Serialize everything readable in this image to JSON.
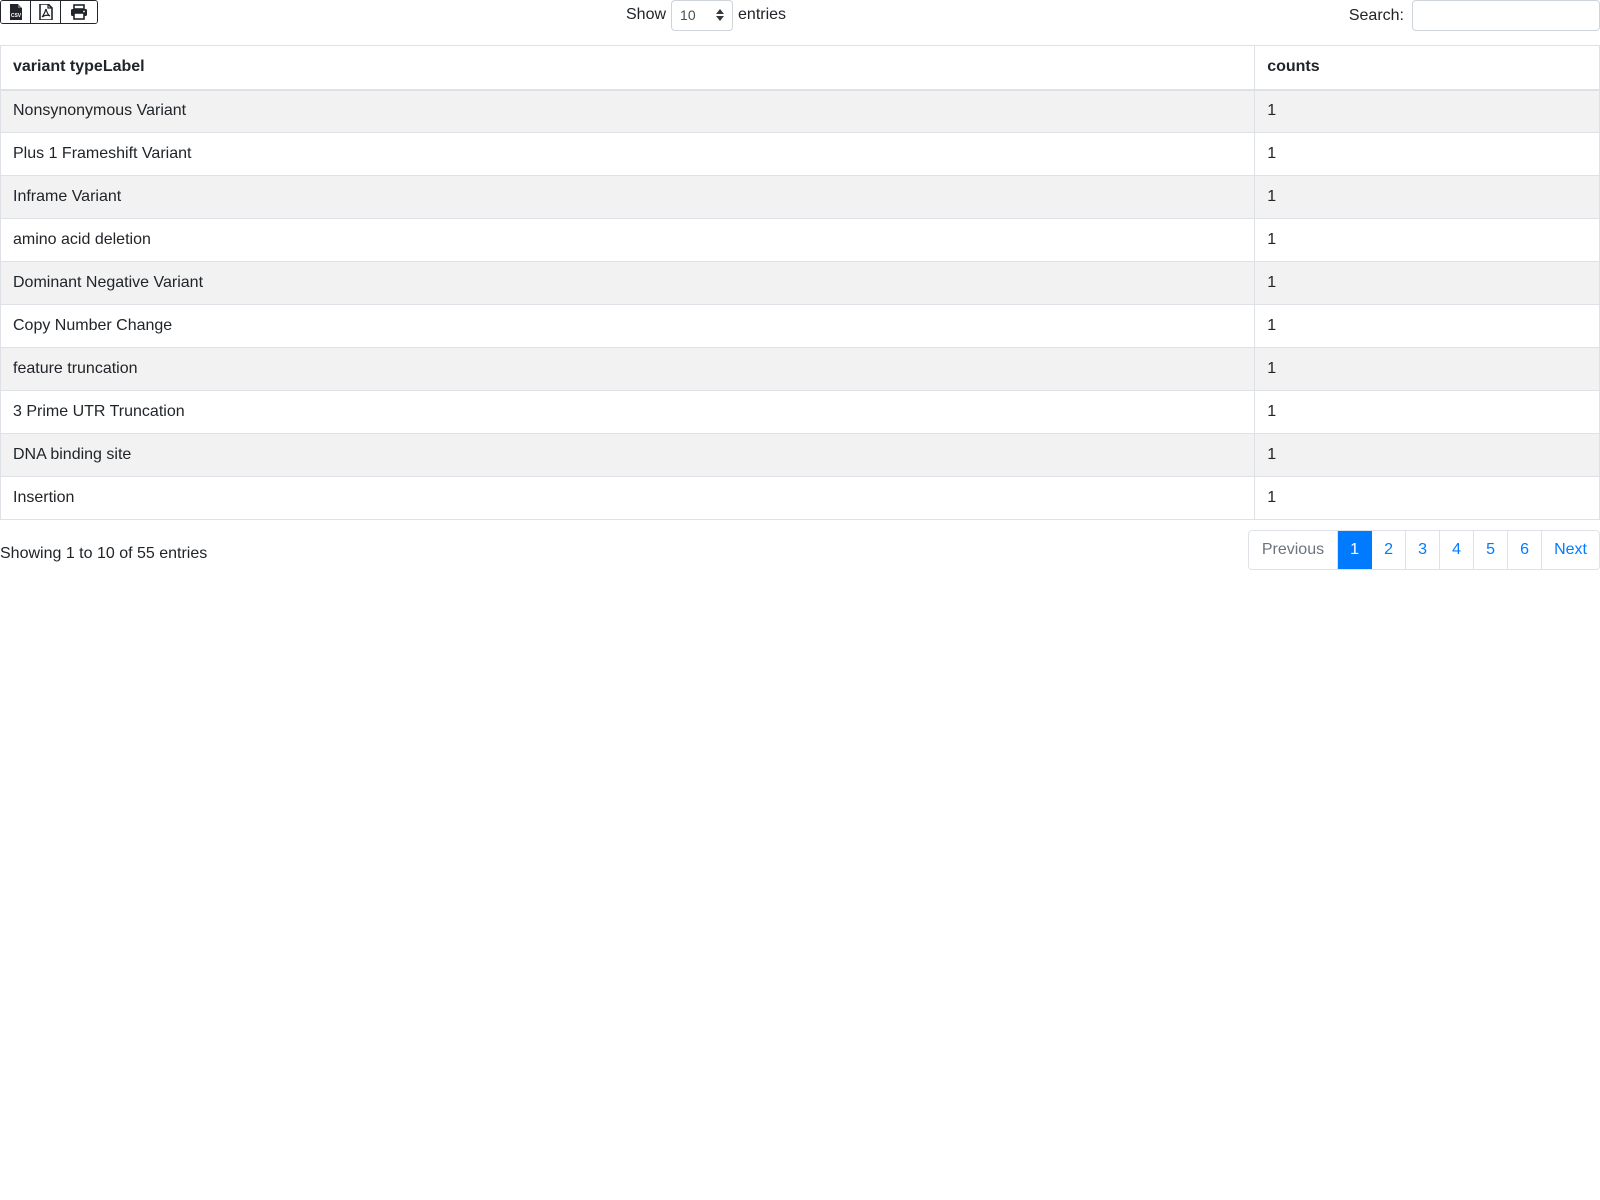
{
  "toolbar": {
    "export_buttons": [
      {
        "icon": "csv-file-icon",
        "badge": "CSV"
      },
      {
        "icon": "pdf-file-icon"
      },
      {
        "icon": "print-icon"
      }
    ]
  },
  "length": {
    "label_before": "Show",
    "selected": "10",
    "label_after": "entries"
  },
  "search": {
    "label": "Search:",
    "value": "",
    "placeholder": ""
  },
  "table": {
    "columns": [
      "variant typeLabel",
      "counts"
    ],
    "rows": [
      [
        "Nonsynonymous Variant",
        "1"
      ],
      [
        "Plus 1 Frameshift Variant",
        "1"
      ],
      [
        "Inframe Variant",
        "1"
      ],
      [
        "amino acid deletion",
        "1"
      ],
      [
        "Dominant Negative Variant",
        "1"
      ],
      [
        "Copy Number Change",
        "1"
      ],
      [
        "feature truncation",
        "1"
      ],
      [
        "3 Prime UTR Truncation",
        "1"
      ],
      [
        "DNA binding site",
        "1"
      ],
      [
        "Insertion",
        "1"
      ]
    ]
  },
  "footer": {
    "info": "Showing 1 to 10 of 55 entries",
    "pagination": {
      "previous": "Previous",
      "pages": [
        "1",
        "2",
        "3",
        "4",
        "5",
        "6"
      ],
      "active_page": "1",
      "next": "Next"
    }
  },
  "colors": {
    "accent": "#007bff",
    "stripe": "#f2f2f2",
    "border": "#dee2e6",
    "text": "#212529",
    "muted": "#6c757d"
  }
}
